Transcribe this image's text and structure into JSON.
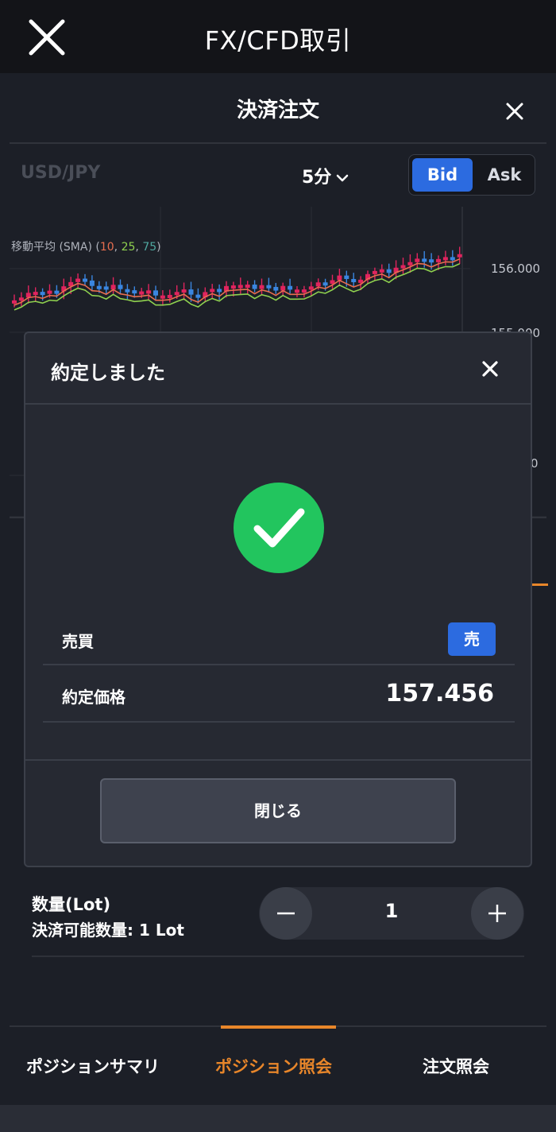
{
  "app_title": "FX/CFD取引",
  "sheet": {
    "title": "決済注文",
    "symbol": "USD/JPY",
    "timeframe": "5分",
    "price_type": {
      "bid": "Bid",
      "ask": "Ask",
      "selected": "Bid"
    }
  },
  "chart": {
    "sma_label": "移動平均 (SMA) (",
    "sma_periods": [
      "10",
      "25",
      "75"
    ],
    "sma_colors": [
      "#e86e4f",
      "#8fd14f",
      "#4fa8a0"
    ],
    "up_color": "#e0245e",
    "down_color": "#3a86e0",
    "price_labels": [
      "156.000",
      "155.000",
      "0"
    ]
  },
  "modal": {
    "title": "約定しました",
    "side_label": "売買",
    "side_value": "売",
    "price_label": "約定価格",
    "price_value": "157.456",
    "close_button": "閉じる"
  },
  "quantity": {
    "label": "数量(Lot)",
    "available": "決済可能数量: 1 Lot",
    "value": "1"
  },
  "tabs": [
    {
      "label": "ポジションサマリ",
      "active": false
    },
    {
      "label": "ポジション照会",
      "active": true
    },
    {
      "label": "注文照会",
      "active": false
    }
  ],
  "colors": {
    "accent_blue": "#2c6be0",
    "success_green": "#22c55e",
    "active_tab": "#e8862a"
  }
}
